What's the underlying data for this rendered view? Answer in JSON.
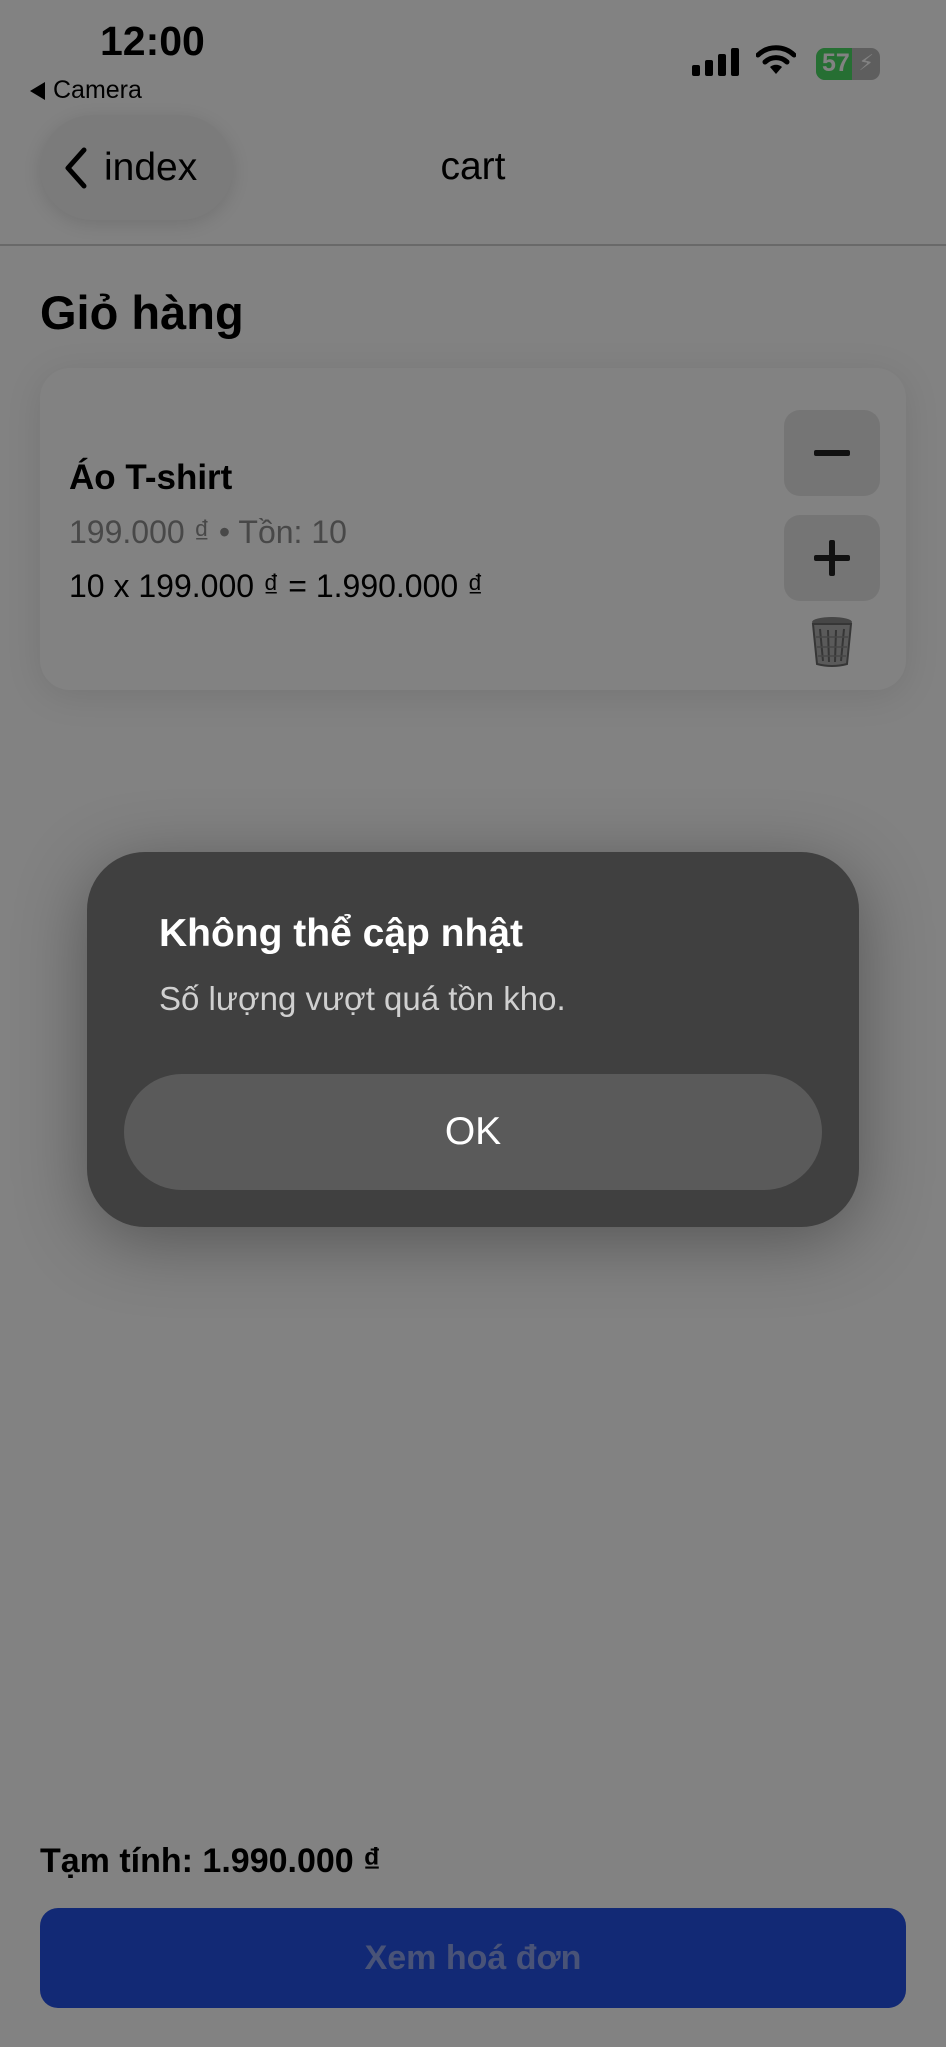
{
  "status_bar": {
    "time": "12:00",
    "back_app": "Camera",
    "battery_percent": "57",
    "battery_level": 0.57
  },
  "nav": {
    "back_label": "index",
    "title": "cart"
  },
  "page": {
    "heading": "Giỏ hàng"
  },
  "cart": {
    "items": [
      {
        "name": "Áo T-shirt",
        "meta": "199.000 ₫ • Tồn: 10",
        "line_total": "10 x 199.000 ₫ = 1.990.000 ₫"
      }
    ]
  },
  "footer": {
    "subtotal": "Tạm tính: 1.990.000 ₫",
    "checkout_label": "Xem hoá đơn"
  },
  "alert": {
    "title": "Không thể cập nhật",
    "message": "Số lượng vượt quá tồn kho.",
    "ok_label": "OK"
  },
  "colors": {
    "primary": "#2451e6",
    "battery_fill": "#4cd964",
    "alert_bg": "#404040"
  }
}
